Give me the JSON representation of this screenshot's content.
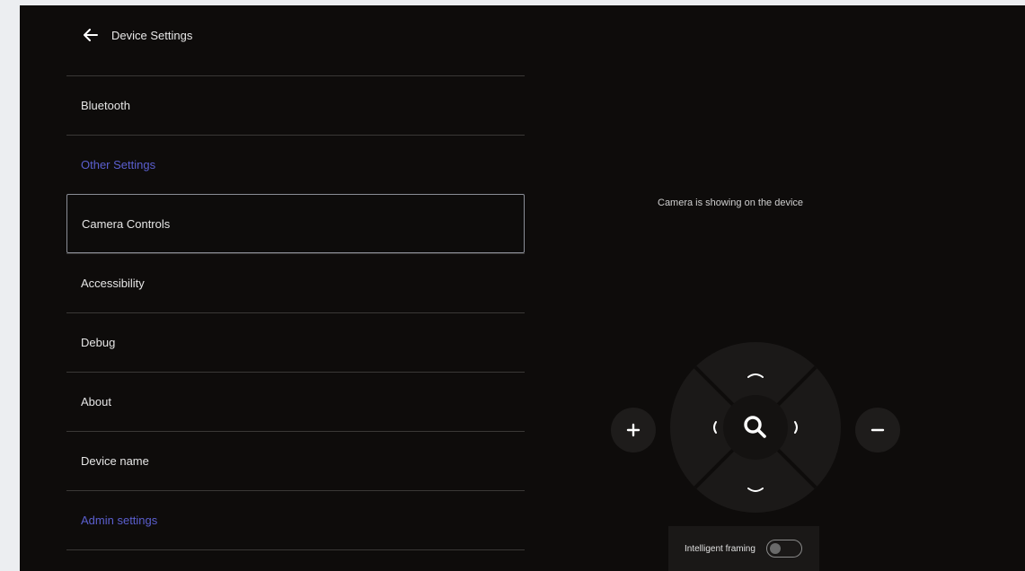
{
  "header": {
    "title": "Device Settings",
    "back_icon": "arrow-left-icon"
  },
  "menu": {
    "items": [
      {
        "label": "Bluetooth",
        "type": "item"
      },
      {
        "label": "Other Settings",
        "type": "section"
      },
      {
        "label": "Camera Controls",
        "type": "item",
        "selected": true
      },
      {
        "label": "Accessibility",
        "type": "item"
      },
      {
        "label": "Debug",
        "type": "item"
      },
      {
        "label": "About",
        "type": "item"
      },
      {
        "label": "Device name",
        "type": "item"
      },
      {
        "label": "Admin settings",
        "type": "section"
      }
    ]
  },
  "camera": {
    "status_text": "Camera is showing on the device",
    "zoom_in_icon": "plus-icon",
    "zoom_out_icon": "minus-icon",
    "center_icon": "search-icon"
  },
  "framing": {
    "label": "Intelligent framing",
    "enabled": false
  },
  "colors": {
    "background": "#0e0c0b",
    "section_accent": "#5b5fcf",
    "text": "#e6e6e6",
    "divider": "#3a3836"
  }
}
